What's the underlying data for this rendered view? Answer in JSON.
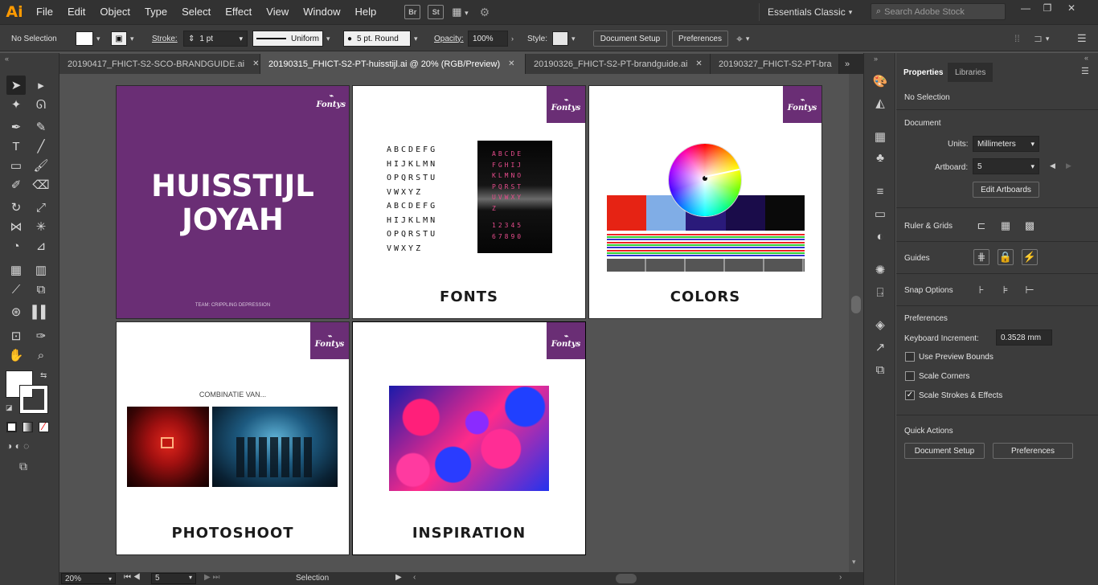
{
  "app": {
    "logo": "Ai"
  },
  "menu": [
    "File",
    "Edit",
    "Object",
    "Type",
    "Select",
    "Effect",
    "View",
    "Window",
    "Help"
  ],
  "appbar": {
    "bridge": "Br",
    "stock": "St",
    "workspace": "Essentials Classic",
    "search_placeholder": "Search Adobe Stock"
  },
  "control": {
    "selection": "No Selection",
    "stroke_label": "Stroke:",
    "stroke_weight": "1 pt",
    "profile": "Uniform",
    "brush": "5 pt. Round",
    "opacity_label": "Opacity:",
    "opacity": "100%",
    "style_label": "Style:",
    "doc_setup": "Document Setup",
    "preferences": "Preferences"
  },
  "tabs": [
    {
      "label": "20190417_FHICT-S2-SCO-BRANDGUIDE.ai",
      "active": false
    },
    {
      "label": "20190315_FHICT-S2-PT-huisstijl.ai @ 20% (RGB/Preview)",
      "active": true
    },
    {
      "label": "20190326_FHICT-S2-PT-brandguide.ai",
      "active": false
    },
    {
      "label": "20190327_FHICT-S2-PT-bra",
      "active": false
    }
  ],
  "artboards": {
    "cover": {
      "line1": "HUISSTIJL",
      "line2": "JOYAH",
      "footer": "TEAM: CRIPPLING DEPRESSION",
      "bg": "#6a2e75"
    },
    "brand": "Fontys",
    "fonts": {
      "heading": "FONTS",
      "rows": [
        "ABCDEFG",
        "HIJKLMN",
        "OPQRSTU",
        "VWXYZ",
        "ABCDEFG",
        "HIJKLMN",
        "OPQRSTU",
        "VWXYZ"
      ],
      "dark_rows": [
        "ABCDE",
        "FGHIJ",
        "KLMNO",
        "PQRST",
        "UVWXY",
        "Z",
        "12345",
        "67890"
      ]
    },
    "colors": {
      "heading": "COLORS",
      "swatches": [
        "#e62314",
        "#80ade6",
        "#2a1a7a",
        "#1a0c4a",
        "#0a0a0a"
      ]
    },
    "photoshoot": {
      "heading": "PHOTOSHOOT",
      "caption": "COMBINATIE VAN..."
    },
    "inspiration": {
      "heading": "INSPIRATION"
    }
  },
  "properties": {
    "tab_properties": "Properties",
    "tab_libraries": "Libraries",
    "no_selection": "No Selection",
    "document": "Document",
    "units_label": "Units:",
    "units": "Millimeters",
    "artboard_label": "Artboard:",
    "artboard": "5",
    "edit_artboards": "Edit Artboards",
    "rulers": "Ruler & Grids",
    "guides": "Guides",
    "snap": "Snap Options",
    "preferences": "Preferences",
    "keyboard_label": "Keyboard Increment:",
    "keyboard_value": "0.3528 mm",
    "preview_bounds": "Use Preview Bounds",
    "scale_corners": "Scale Corners",
    "scale_strokes": "Scale Strokes & Effects",
    "quick_actions": "Quick Actions",
    "qa_doc_setup": "Document Setup",
    "qa_preferences": "Preferences"
  },
  "status": {
    "zoom": "20%",
    "artboard": "5",
    "mode": "Selection"
  }
}
